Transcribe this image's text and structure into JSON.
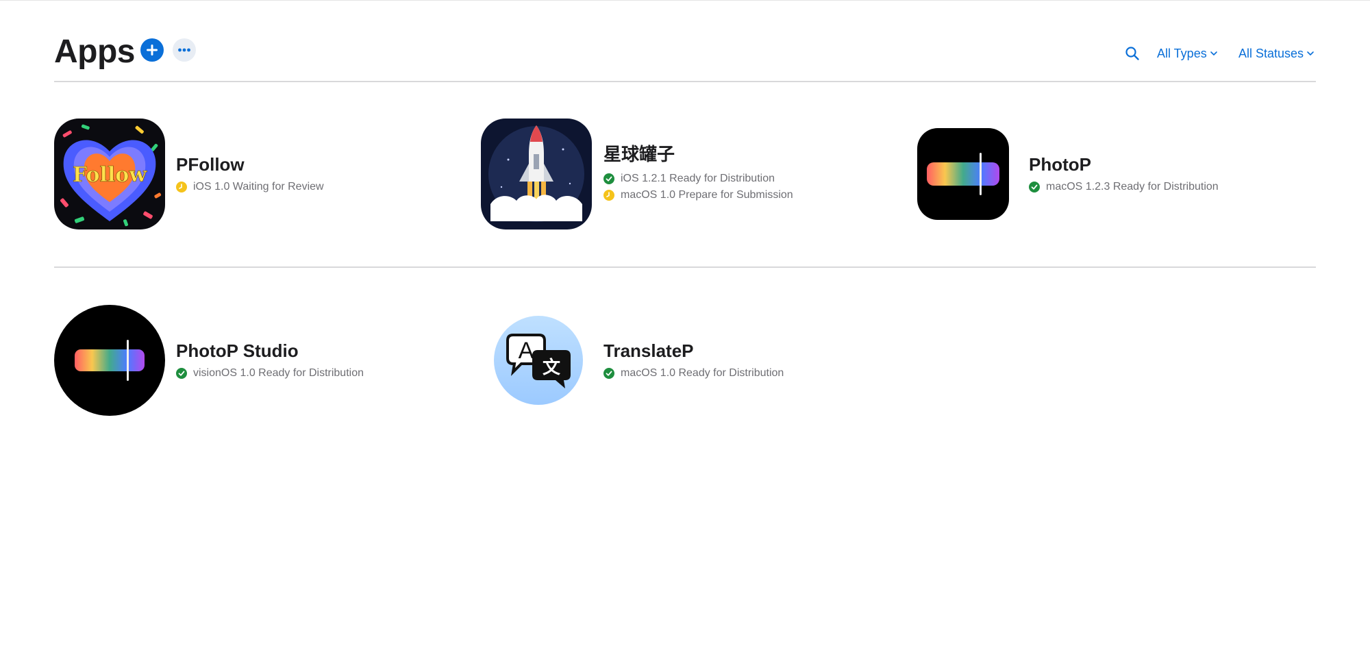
{
  "header": {
    "title": "Apps",
    "filter_types": "All Types",
    "filter_statuses": "All Statuses"
  },
  "colors": {
    "accent": "#0a6fd8",
    "ready_green": "#1e8e3e",
    "waiting_yellow": "#f5c31b"
  },
  "apps": [
    {
      "name": "PFollow",
      "icon_text": "Follow",
      "statuses": [
        {
          "text": "iOS 1.0 Waiting for Review",
          "state": "waiting"
        }
      ]
    },
    {
      "name": "星球罐子",
      "statuses": [
        {
          "text": "iOS 1.2.1 Ready for Distribution",
          "state": "ready"
        },
        {
          "text": "macOS 1.0 Prepare for Submission",
          "state": "waiting"
        }
      ]
    },
    {
      "name": "PhotoP",
      "statuses": [
        {
          "text": "macOS 1.2.3 Ready for Distribution",
          "state": "ready"
        }
      ]
    },
    {
      "name": "PhotoP Studio",
      "statuses": [
        {
          "text": "visionOS 1.0 Ready for Distribution",
          "state": "ready"
        }
      ]
    },
    {
      "name": "TranslateP",
      "icon_text_a": "A",
      "icon_text_b": "文",
      "statuses": [
        {
          "text": "macOS 1.0 Ready for Distribution",
          "state": "ready"
        }
      ]
    }
  ]
}
